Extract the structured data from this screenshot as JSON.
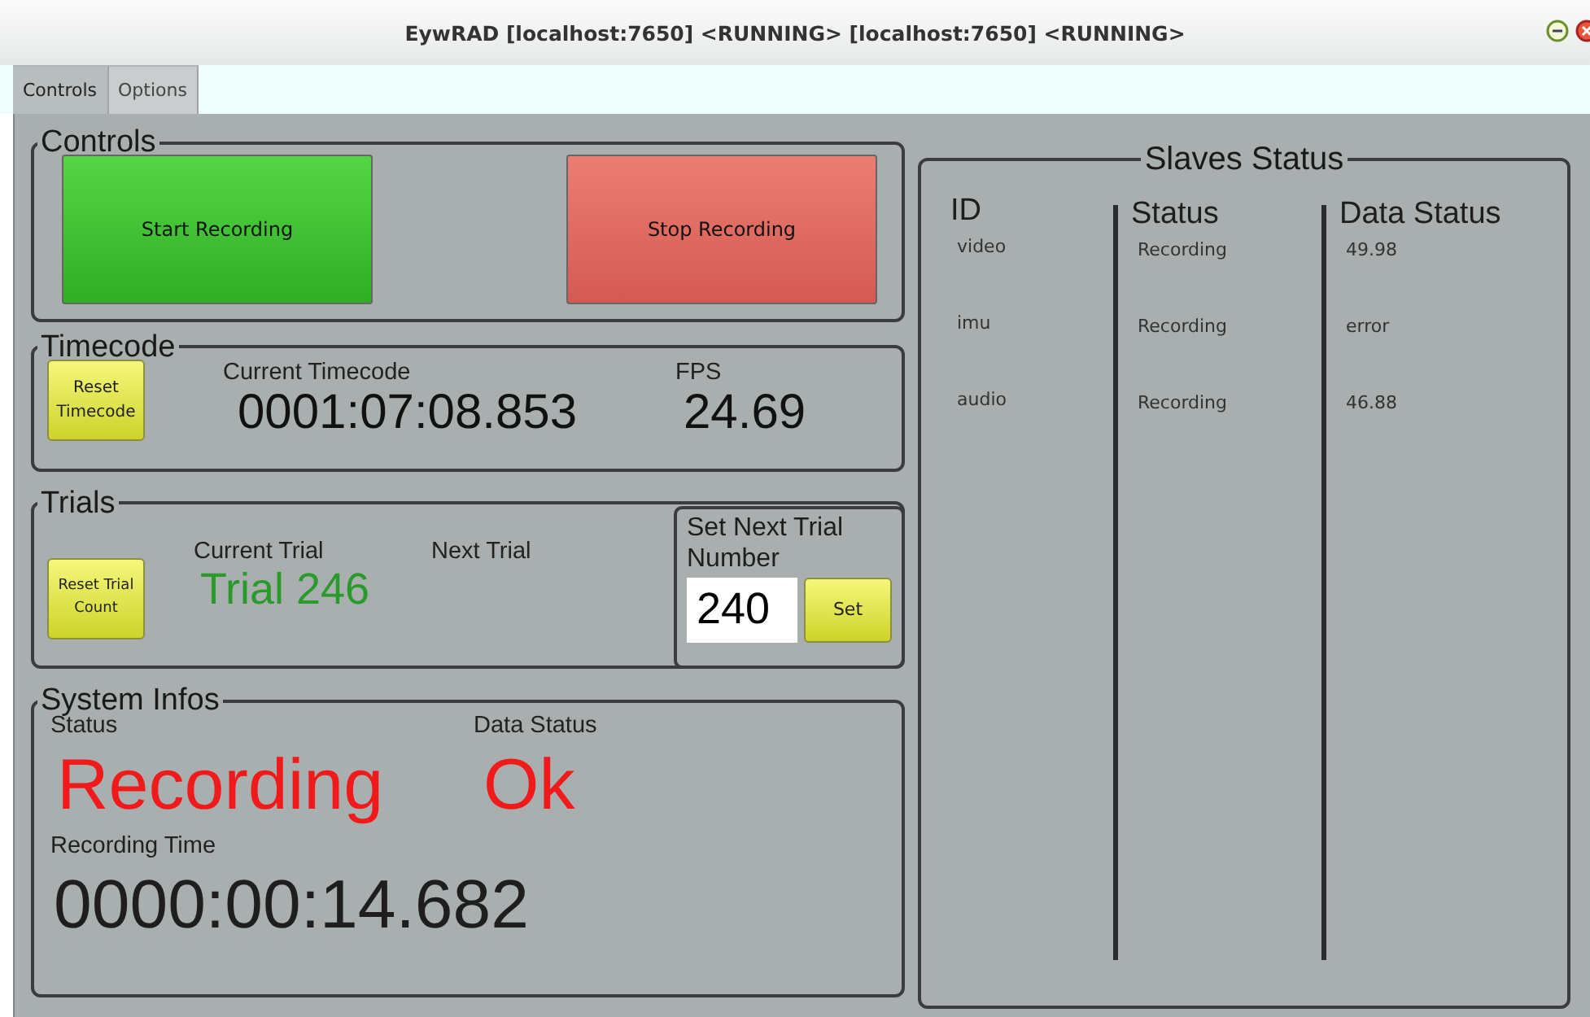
{
  "window": {
    "title": "EywRAD [localhost:7650] <RUNNING> [localhost:7650] <RUNNING>"
  },
  "tabs": [
    {
      "label": "Controls",
      "selected": true
    },
    {
      "label": "Options",
      "selected": false
    }
  ],
  "controls": {
    "title": "Controls",
    "buttons": [
      {
        "label": "Start Recording",
        "kind": "start"
      },
      {
        "label": "Stop Recording",
        "kind": "stop"
      }
    ]
  },
  "timecode": {
    "title": "Timecode",
    "reset_button": "Reset Timecode",
    "current_timecode_label": "Current Timecode",
    "current_timecode": "0001:07:08.853",
    "fps_label": "FPS",
    "fps": "24.69"
  },
  "trials": {
    "title": "Trials",
    "reset_button": "Reset Trial Count",
    "current_trial_label": "Current Trial",
    "current_trial": "Trial 246",
    "next_trial_label": "Next Trial",
    "set_next": {
      "title": "Set Next Trial Number",
      "value": "240",
      "button": "Set"
    }
  },
  "system_infos": {
    "title": "System Infos",
    "status_label": "Status",
    "status": "Recording",
    "data_status_label": "Data Status",
    "data_status": "Ok",
    "recording_time_label": "Recording Time",
    "recording_time": "0000:00:14.682"
  },
  "slaves_status": {
    "title": "Slaves Status",
    "columns": [
      "ID",
      "Status",
      "Data Status"
    ],
    "rows": [
      [
        "video",
        "Recording",
        "49.98"
      ],
      [
        "imu",
        "Recording",
        "error"
      ],
      [
        "audio",
        "Recording",
        "46.88"
      ]
    ]
  }
}
